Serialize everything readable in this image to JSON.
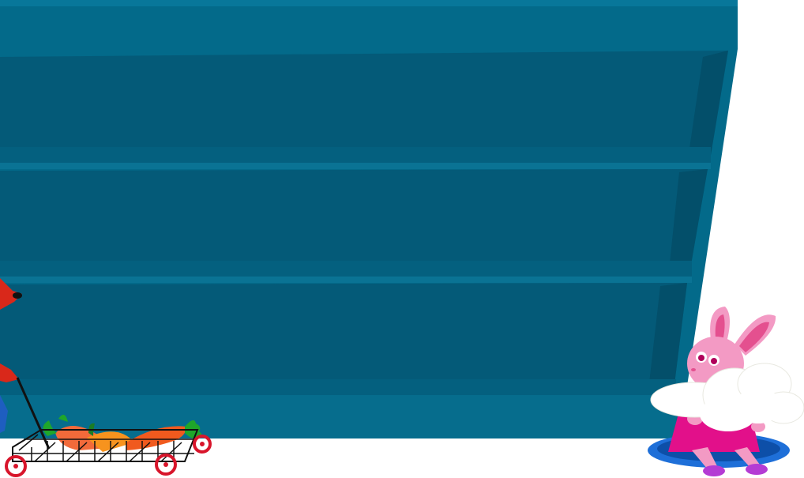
{
  "scene": {
    "colors": {
      "background": "#ffffff",
      "shelf_frame": "#036a8a",
      "shelf_frame_top": "#066d8d",
      "shelf_back": "#045a78",
      "shelf_inner_side": "#034f6a",
      "shelf_board_top": "#04607f",
      "shelf_board_front": "#0a7394",
      "cart_wire": "#111111",
      "cart_wheel": "#d8152b",
      "carrot": "#f05a1e",
      "carrot_leaf": "#1fa62a",
      "bunny_pink": "#f39ac4",
      "bunny_inner_ear": "#e4508f",
      "dress": "#e2108a",
      "shoes": "#b43bd4",
      "rabbit_hole": "#1e6fd8",
      "cloud": "#ffffff",
      "fox_red": "#d9281a"
    },
    "icons": [
      "shelf-icon",
      "shopping-cart-icon",
      "carrot-icon",
      "bunny-icon",
      "cloud-icon",
      "rabbit-hole-icon",
      "fox-icon"
    ]
  }
}
